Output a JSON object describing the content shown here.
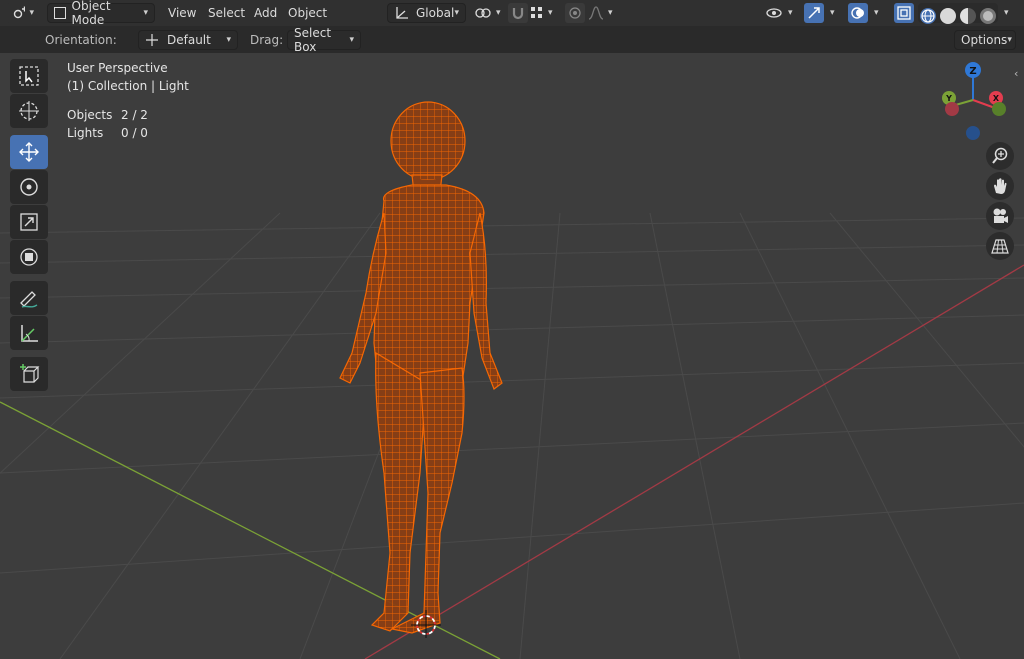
{
  "header": {
    "mode_label": "Object Mode",
    "menus": [
      "View",
      "Select",
      "Add",
      "Object"
    ],
    "transform_orientation": "Global"
  },
  "tool_settings": {
    "orientation_label": "Orientation:",
    "orientation_value": "Default",
    "drag_label": "Drag:",
    "drag_value": "Select Box",
    "options_label": "Options"
  },
  "viewport": {
    "view_name": "User Perspective",
    "collection_info": "(1) Collection | Light",
    "stats": [
      {
        "label": "Objects",
        "value": "2 / 2"
      },
      {
        "label": "Lights",
        "value": "0 / 0"
      }
    ]
  },
  "gizmo": {
    "z_label": "Z",
    "y_label": "Y",
    "x_label": "X"
  },
  "colors": {
    "selection_orange": "#ff6a00",
    "active_blue": "#4772b3",
    "x_axis": "#e33d4f",
    "y_axis": "#7ba236",
    "z_axis": "#2f78d6"
  }
}
